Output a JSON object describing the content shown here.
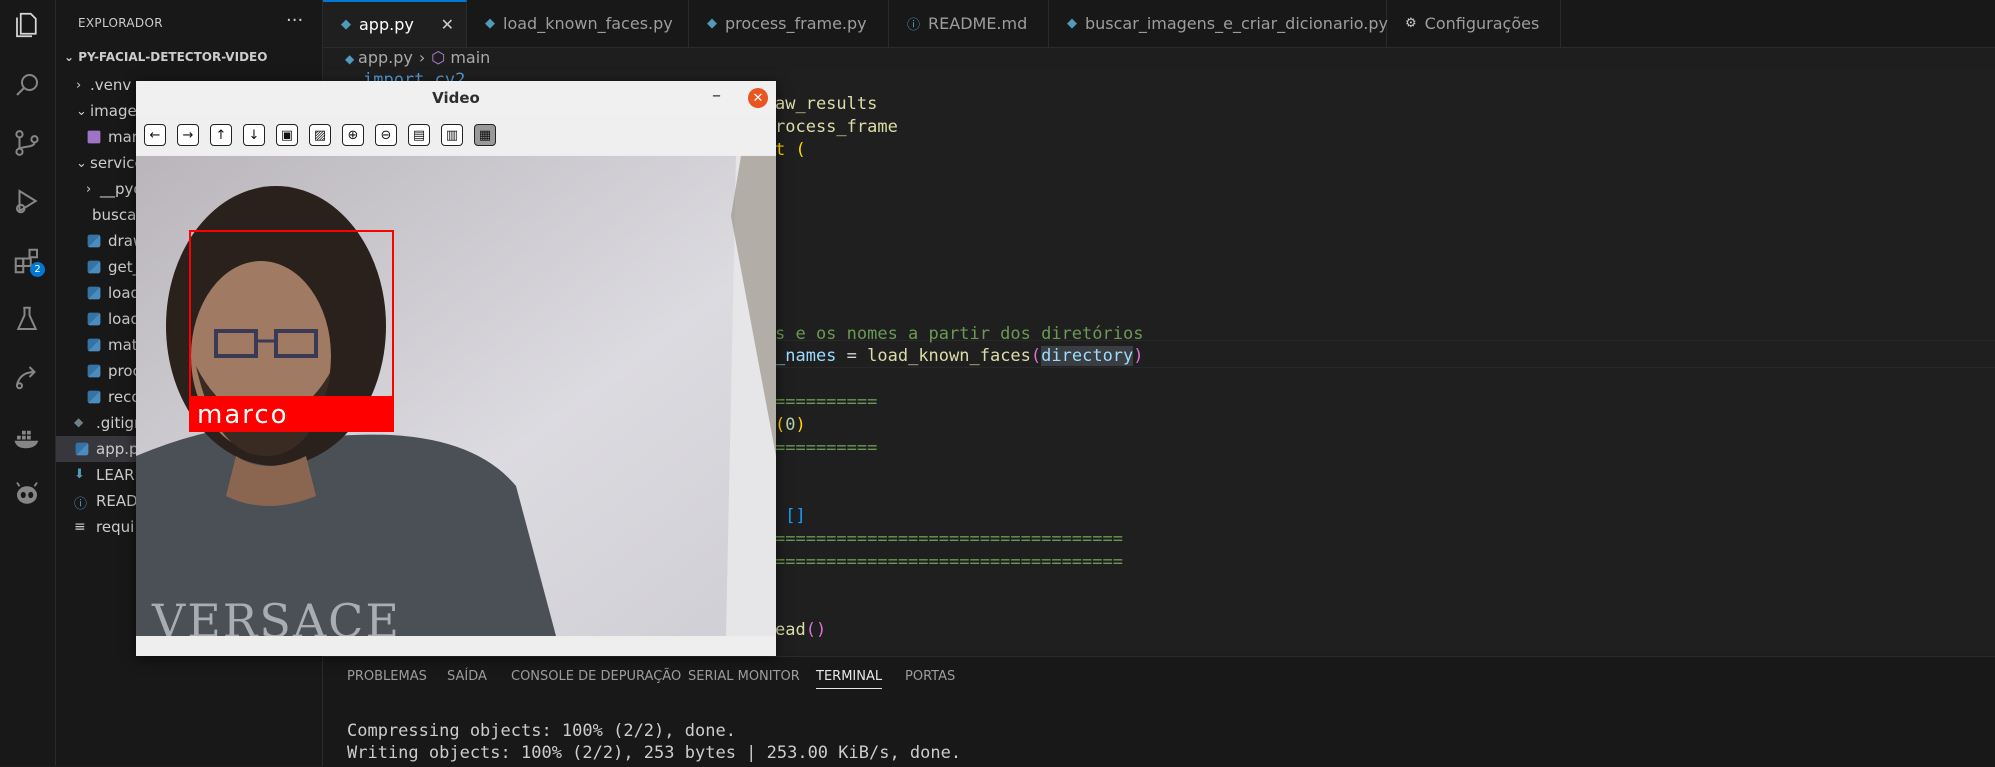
{
  "sidebar": {
    "header": "EXPLORADOR",
    "more": "···",
    "project": "PY-FACIAL-DETECTOR-VIDEO",
    "items": [
      {
        "label": ".venv",
        "type": "folder-closed"
      },
      {
        "label": "images",
        "type": "folder-open"
      },
      {
        "label": "marco",
        "type": "image"
      },
      {
        "label": "services",
        "type": "folder-open"
      },
      {
        "label": "__pycache__",
        "type": "folder-closed"
      },
      {
        "label": "buscar_imagens_e_criar_dicionario.py",
        "type": "py"
      },
      {
        "label": "draw_results.py",
        "type": "py"
      },
      {
        "label": "get_",
        "type": "py"
      },
      {
        "label": "load",
        "type": "py"
      },
      {
        "label": "load",
        "type": "py"
      },
      {
        "label": "match",
        "type": "py"
      },
      {
        "label": "process_frame.py",
        "type": "py"
      },
      {
        "label": "reco",
        "type": "py"
      },
      {
        "label": ".gitignore",
        "type": "git"
      },
      {
        "label": "app.py",
        "type": "py"
      },
      {
        "label": "LEARN",
        "type": "md-down"
      },
      {
        "label": "READ",
        "type": "info"
      },
      {
        "label": "requi",
        "type": "txt"
      }
    ]
  },
  "activity": {
    "badge": "2"
  },
  "tabs": [
    {
      "label": "app.py",
      "close": "✕"
    },
    {
      "label": "load_known_faces.py"
    },
    {
      "label": "process_frame.py"
    },
    {
      "label": "README.md"
    },
    {
      "label": "buscar_imagens_e_criar_dicionario.py"
    },
    {
      "label": "Configurações"
    }
  ],
  "breadcrumb": {
    "file": "app.py",
    "symbol": "main"
  },
  "code": {
    "l1_a": "import cv2",
    "l2_a": "aw_results",
    "l3_a": "rocess_frame",
    "l4_a": "t (",
    "l11_a": "s e os nomes a partir dos diretórios",
    "l12_a": "_names",
    "l12_b": " = ",
    "l12_c": "load_known_faces",
    "l12_d": "(",
    "l12_e": "directory",
    "l12_f": ")",
    "l14_a": "==========",
    "l15_a": "(",
    "l15_b": "0",
    "l15_c": ")",
    "l16_a": "==========",
    "l19_a": " []",
    "l20_a": "==================================",
    "l21_a": "==================================",
    "l24_a": "ead",
    "l24_b": "()"
  },
  "panel": {
    "tabs": [
      "PROBLEMAS",
      "SAÍDA",
      "CONSOLE DE DEPURAÇÃO",
      "SERIAL MONITOR",
      "TERMINAL",
      "PORTAS"
    ],
    "active": "TERMINAL",
    "lines": [
      "Compressing objects: 100% (2/2), done.",
      "Writing objects: 100% (2/2), 253 bytes | 253.00 KiB/s, done."
    ]
  },
  "video_window": {
    "title": "Video",
    "minimize": "–",
    "close": "✕",
    "toolbar_icons": [
      "arrow-left-icon",
      "arrow-right-icon",
      "arrow-up-icon",
      "arrow-down-icon",
      "image-icon",
      "image-zoom-icon",
      "zoom-in-icon",
      "zoom-out-icon",
      "save-icon",
      "clipboard-icon",
      "properties-icon"
    ],
    "face_label": "marco",
    "shirt_text": "VERSACE"
  },
  "colors": {
    "accent": "#0078d4",
    "face_box": "#ff0000",
    "close": "#e95420"
  }
}
